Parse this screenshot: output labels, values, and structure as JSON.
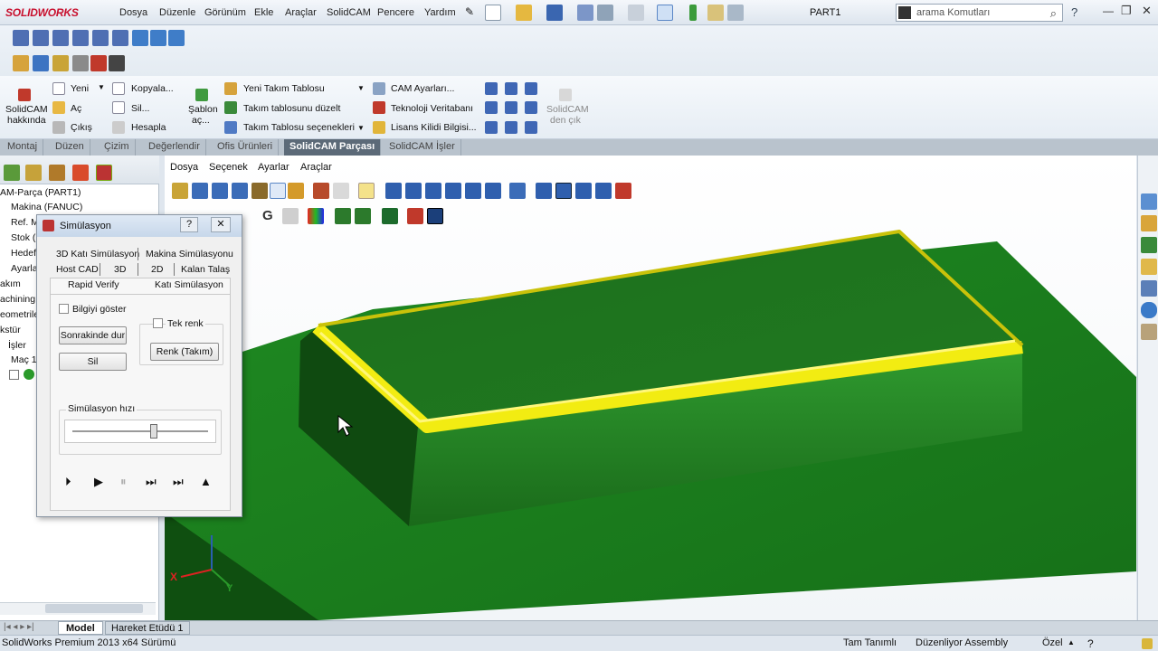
{
  "app": {
    "logo": "SOLIDWORKS",
    "menu": [
      "Dosya",
      "Düzenle",
      "Görünüm",
      "Ekle",
      "Araçlar",
      "SolidCAM",
      "Pencere",
      "Yardım"
    ],
    "doc_title": "PART1",
    "search_placeholder": "arama Komutları"
  },
  "ribbon": {
    "about_l1": "SolidCAM",
    "about_l2": "hakkında",
    "new": "Yeni",
    "open": "Aç",
    "exit": "Çıkış",
    "copy": "Kopyala...",
    "delete": "Sil...",
    "calculate": "Hesapla",
    "templates_l1": "Şablon",
    "templates_l2": "aç...",
    "new_tool_table": "Yeni Takım Tablosu",
    "edit_tool_table": "Takım tablosunu düzelt",
    "tool_table_options": "Takım Tablosu seçenekleri",
    "cam_settings": "CAM Ayarları...",
    "tech_db": "Teknoloji Veritabanı",
    "license_info": "Lisans Kilidi Bilgisi...",
    "exit_solidcam_l1": "SolidCAM",
    "exit_solidcam_l2": "den çık"
  },
  "command_tabs": [
    "Montaj",
    "Düzen",
    "Çizim",
    "Değerlendir",
    "Ofis Ürünleri",
    "SolidCAM Parçası",
    "SolidCAM İşler"
  ],
  "tree": [
    "AM-Parça (PART1)",
    "Makina (FANUC)",
    "Ref. M",
    "Stok (",
    "Hedef",
    "Ayarla",
    "akım",
    "achining",
    "eometrile",
    "kstür",
    "İşler",
    "Maç 1"
  ],
  "viewport_menu": [
    "Dosya",
    "Seçenek",
    "Ayarlar",
    "Araçlar"
  ],
  "simulation_dialog": {
    "title": "Simülasyon",
    "help": "?",
    "close": "✕",
    "tabs_row1": [
      "3D Katı Simülasyon",
      "Makina Simülasyonu"
    ],
    "tabs_row2": [
      "Host CAD",
      "3D",
      "2D",
      "Kalan Talaş"
    ],
    "tabs_row3": [
      "Rapid Verify",
      "Katı Simülasyon"
    ],
    "show_info": "Bilgiyi göster",
    "single_color": "Tek renk",
    "stop_next": "Sonrakinde dur",
    "delete": "Sil",
    "color_tool": "Renk (Takım)",
    "speed_label": "Simülasyon hızı",
    "speed": 0.6
  },
  "bottom_tabs": [
    "Model",
    "Hareket Etüdü 1"
  ],
  "status": {
    "left": "SolidWorks Premium 2013 x64 Sürümü",
    "defined": "Tam Tanımlı",
    "editing": "Düzenliyor Assembly",
    "custom": "Özel"
  },
  "colors": {
    "part_green": "#1f7a1f",
    "fillet_yellow": "#f2ec12",
    "stock_green": "#1e8c24",
    "accent_blue": "#2a5fb0"
  }
}
